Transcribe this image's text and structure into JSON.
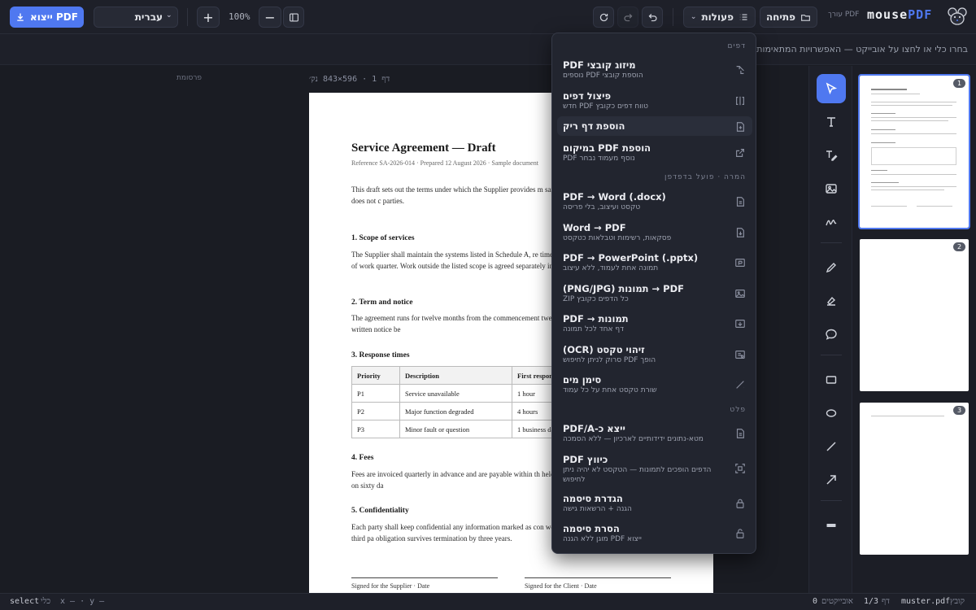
{
  "brand": {
    "name_a": "mouse",
    "name_b": "PDF",
    "subtitle": "עורך PDF"
  },
  "header": {
    "open_label": "פתיחה",
    "actions_label": "פעולות",
    "zoom": "100%",
    "language": "עברית",
    "export_label": "ייצוא PDF"
  },
  "hint": "בחרו כלי או לחצו על אובייקט — האפשרויות המתאימות יופיעו כאן",
  "canvas": {
    "ad_label": "פרסומת",
    "page_info": "דף 1 · 596×843 נק׳"
  },
  "document": {
    "title": "Service Agreement — Draft",
    "reference": "Reference SA-2026-014 · Prepared 12 August 2026 · Sample document",
    "intro": "This draft sets out the terms under which the Supplier provides m sample document used to demonstrate a PDF editor and does not c parties.",
    "s1_heading": "1. Scope of services",
    "s1_text": "The Supplier shall maintain the systems listed in Schedule A, re times set out in clause 3, and provide a written summary of work quarter. Work outside the listed scope is agreed separately in writin",
    "s2_heading": "2. Term and notice",
    "s2_text": "The agreement runs for twelve months from the commencement twelve months unless either party gives sixty days written notice be",
    "s3_heading": "3. Response times",
    "table_headers": [
      "Priority",
      "Description",
      "First respon"
    ],
    "table_rows": [
      [
        "P1",
        "Service unavailable",
        "1 hour"
      ],
      [
        "P2",
        "Major function degraded",
        "4 hours"
      ],
      [
        "P3",
        "Minor fault or question",
        "1 business da"
      ]
    ],
    "s4_heading": "4. Fees",
    "s4_text": "Fees are invoiced quarterly in advance and are payable within th held for the initial term and may be adjusted at renewal on sixty da",
    "s5_heading": "5. Confidentiality",
    "s5_text": "Each party shall keep confidential any information marked as con would treat as confidential, and shall not disclose it to a third pa obligation survives termination by three years.",
    "sig_supplier": "Signed for the Supplier · Date",
    "sig_client": "Signed for the Client · Date"
  },
  "menu": {
    "sections": {
      "pages": "דפים",
      "convert": "המרה · פועל בדפדפן",
      "output": "פלט"
    },
    "items": [
      {
        "label": "מיזוג קובצי PDF",
        "sub": "הוספת קובצי PDF נוספים",
        "icon": "merge-icon"
      },
      {
        "label": "פיצול דפים",
        "sub": "טווח דפים כקובץ PDF חדש",
        "icon": "split-icon"
      },
      {
        "label": "הוספת דף ריק",
        "sub": "",
        "icon": "blank-page-icon"
      },
      {
        "label": "הוספת PDF במיקום",
        "sub": "PDF נוסף מעמוד נבחר",
        "icon": "insert-icon"
      },
      {
        "label": "PDF → Word (.docx)",
        "sub": "טקסט ועיצוב, בלי פריסה",
        "icon": "word-icon"
      },
      {
        "label": "Word → PDF",
        "sub": "פסקאות, רשימות וטבלאות כטקסט",
        "icon": "doc-icon"
      },
      {
        "label": "PDF → PowerPoint (.pptx)",
        "sub": "תמונה אחת לעמוד, ללא עיצוב",
        "icon": "slides-icon"
      },
      {
        "label": "(PNG/JPG) תמונות → PDF",
        "sub": "כל הדפים כקובץ ZIP",
        "icon": "image-icon"
      },
      {
        "label": "PDF → תמונות",
        "sub": "דף אחד לכל תמונה",
        "icon": "image-export-icon"
      },
      {
        "label": "זיהוי טקסט (OCR)",
        "sub": "הופך PDF סרוק לניתן לחיפוש",
        "icon": "ocr-icon"
      },
      {
        "label": "סימן מים",
        "sub": "שורת טקסט אחת על כל עמוד",
        "icon": "watermark-icon"
      },
      {
        "label": "ייצא כ-PDF/A",
        "sub": "מטא-נתונים ידידותיים לארכיון — ללא הסמכה",
        "icon": "archive-icon"
      },
      {
        "label": "כיווץ PDF",
        "sub": "הדפים הופכים לתמונות — הטקסט לא יהיה ניתן",
        "sub2": "לחיפוש",
        "icon": "compress-icon"
      },
      {
        "label": "הגדרת סיסמה",
        "sub": "הגנה + הרשאות גישה",
        "icon": "lock-icon"
      },
      {
        "label": "הסרת סיסמה",
        "sub": "ייצוא PDF מוגן ללא הגנה",
        "icon": "unlock-icon"
      }
    ]
  },
  "thumbnails": [
    "1",
    "2",
    "3"
  ],
  "status": {
    "file_label": "קובץ",
    "file_name": "muster.pdf",
    "page_label": "דף",
    "page_value": "1/3",
    "objects_label": "אובייקטים",
    "objects_value": "0",
    "coords": "x — · y —",
    "tool_label": "כלי",
    "tool_value": "select"
  },
  "colors": {
    "accent": "#4f78f0",
    "background": "#1a1c23",
    "panel": "#1e2029"
  }
}
